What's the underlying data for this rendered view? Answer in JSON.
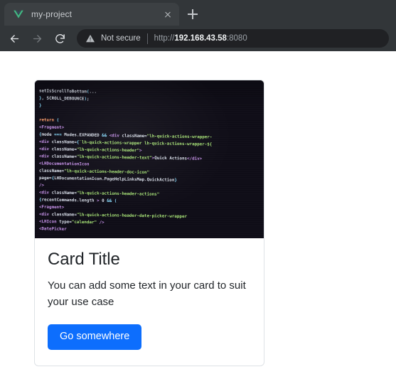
{
  "browser": {
    "tab": {
      "title": "my-project",
      "favicon": "vue-logo-icon",
      "favicon_color": "#41b883",
      "close_label": "×"
    },
    "new_tab_label": "+",
    "nav": {
      "back_label": "Back",
      "forward_label": "Forward",
      "reload_label": "Reload"
    },
    "omnibox": {
      "security_icon": "warning-triangle-icon",
      "security_label": "Not secure",
      "url_scheme": "http://",
      "url_host": "192.168.43.58",
      "url_port": ":8080",
      "url_full": "http://192.168.43.58:8080"
    }
  },
  "card": {
    "image_alt": "code-screenshot",
    "title": "Card Title",
    "text": "You can add some text in your card to suit your use case",
    "button_label": "Go somewhere",
    "button_color": "#0d6efd",
    "border_color": "#dee2e6",
    "code_lines": [
      "      setIsScrollToBottom(...",
      "  }, SCROLL_DEBOUNCE);",
      "}",
      "",
      "return (",
      "  <Fragment>",
      "    {mode === Modes.EXPANDED && <div className=\"lh-quick-actions-wrapper-",
      "    <div className={`lh-quick-actions-wrapper lh-quick-actions-wrapper-${",
      "      <div className=\"lh-quick-actions-header\">",
      "        <div className=\"lh-quick-actions-header-text\">Quick Actions</div>",
      "        <LHDocumentationIcon",
      "          className=\"lh-quick-actions-header-doc-icon\"",
      "          page={LHDocumentationIcon.PageHelpLinksMap.QuickAction}",
      "        />",
      "        <div className=\"lh-quick-actions-header-actions\"",
      "        {recentCommands.length > 0 && (",
      "          <Fragment>",
      "            <div className=\"lh-quick-actions-header-date-picker-wrapper",
      "              <LHIcon type=\"calendar\" />",
      "              <DatePicker"
    ],
    "code_colors": {
      "background": "#0f0d17",
      "tag": "#c792ea",
      "string": "#a5e075",
      "plain": "#d8dee9",
      "keyword": "#ff9d6b",
      "punctuation": "#89ddff",
      "attr": "#e6e6e6"
    }
  }
}
